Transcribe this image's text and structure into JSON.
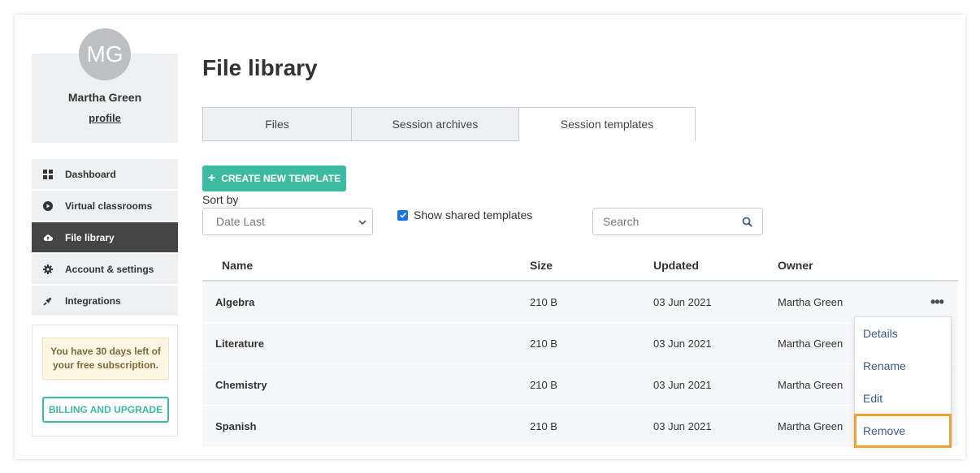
{
  "profile": {
    "initials": "MG",
    "name": "Martha Green",
    "link": "profile"
  },
  "nav": [
    {
      "label": "Dashboard",
      "icon": "dashboard-icon"
    },
    {
      "label": "Virtual classrooms",
      "icon": "play-icon"
    },
    {
      "label": "File library",
      "icon": "cloud-upload-icon",
      "active": true
    },
    {
      "label": "Account & settings",
      "icon": "gear-icon"
    },
    {
      "label": "Integrations",
      "icon": "plug-icon"
    }
  ],
  "promo": {
    "note": "You have 30 days left of your free subscription.",
    "billing_button": "BILLING AND UPGRADE"
  },
  "page": {
    "title": "File library"
  },
  "tabs": [
    {
      "label": "Files"
    },
    {
      "label": "Session archives"
    },
    {
      "label": "Session templates",
      "active": true
    }
  ],
  "toolbar": {
    "create_label": "CREATE NEW TEMPLATE",
    "sort_label": "Sort by",
    "sort_value": "Date Last",
    "shared_label": "Show shared templates",
    "shared_checked": true,
    "search_placeholder": "Search"
  },
  "table": {
    "columns": [
      "Name",
      "Size",
      "Updated",
      "Owner"
    ],
    "rows": [
      {
        "name": "Algebra",
        "size": "210 B",
        "updated": "03 Jun 2021",
        "owner": "Martha Green"
      },
      {
        "name": "Literature",
        "size": "210 B",
        "updated": "03 Jun 2021",
        "owner": "Martha Green"
      },
      {
        "name": "Chemistry",
        "size": "210 B",
        "updated": "03 Jun 2021",
        "owner": "Martha Green"
      },
      {
        "name": "Spanish",
        "size": "210 B",
        "updated": "03 Jun 2021",
        "owner": "Martha Green"
      }
    ],
    "more_glyph": "•••"
  },
  "menu": {
    "items": [
      "Details",
      "Rename",
      "Edit",
      "Remove"
    ],
    "highlighted": "Remove"
  },
  "colors": {
    "accent": "#3dbba0",
    "highlight_outline": "#f0a22e",
    "nav_active": "#454545",
    "link_blue": "#3a5a8a"
  }
}
